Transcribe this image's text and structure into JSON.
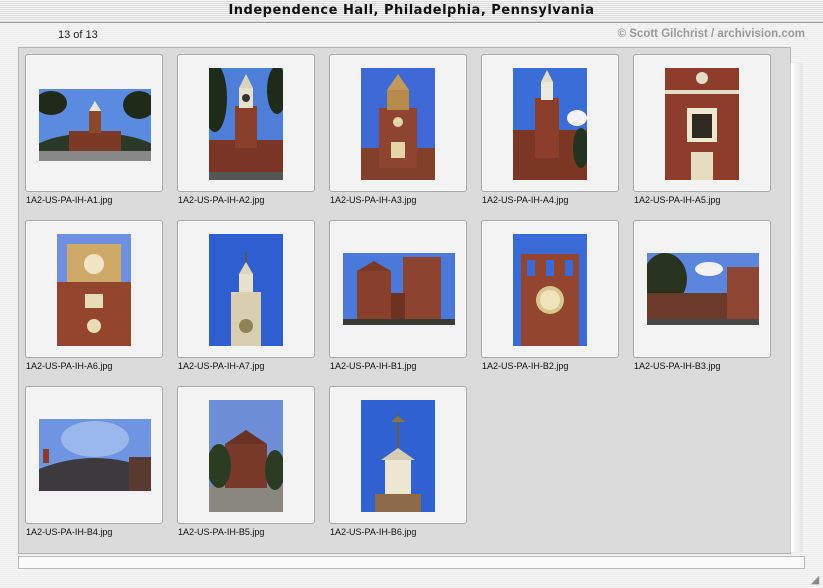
{
  "window": {
    "title": "Independence Hall, Philadelphia, Pennsylvania"
  },
  "header": {
    "count": "13 of 13",
    "credit": "© Scott Gilchrist / archivision.com"
  },
  "images": [
    {
      "filename": "1A2-US-PA-IH-A1.jpg",
      "orientation": "landscape",
      "subject": "fisheye view of hall and tower with trees"
    },
    {
      "filename": "1A2-US-PA-IH-A2.jpg",
      "orientation": "portrait",
      "subject": "hall tower framed by trees"
    },
    {
      "filename": "1A2-US-PA-IH-A3.jpg",
      "orientation": "portrait",
      "subject": "tower with clock, front facade"
    },
    {
      "filename": "1A2-US-PA-IH-A4.jpg",
      "orientation": "portrait",
      "subject": "tower side view, blue sky"
    },
    {
      "filename": "1A2-US-PA-IH-A5.jpg",
      "orientation": "portrait",
      "subject": "brick tower detail with window"
    },
    {
      "filename": "1A2-US-PA-IH-A6.jpg",
      "orientation": "portrait",
      "subject": "clock tower closeup"
    },
    {
      "filename": "1A2-US-PA-IH-A7.jpg",
      "orientation": "portrait",
      "subject": "cupola with clock against blue sky"
    },
    {
      "filename": "1A2-US-PA-IH-B1.jpg",
      "orientation": "landscape",
      "subject": "brick wings of the hall"
    },
    {
      "filename": "1A2-US-PA-IH-B2.jpg",
      "orientation": "portrait",
      "subject": "clock on brick wall"
    },
    {
      "filename": "1A2-US-PA-IH-B3.jpg",
      "orientation": "landscape",
      "subject": "arcade and tree"
    },
    {
      "filename": "1A2-US-PA-IH-B4.jpg",
      "orientation": "landscape",
      "subject": "wide fisheye sky view"
    },
    {
      "filename": "1A2-US-PA-IH-B5.jpg",
      "orientation": "portrait",
      "subject": "distant hall behind trees"
    },
    {
      "filename": "1A2-US-PA-IH-B6.jpg",
      "orientation": "portrait",
      "subject": "steeple top with weathervane"
    }
  ],
  "colors": {
    "sky": "#3f6fd6",
    "brick": "#8e3f2a",
    "pane": "#dbdbdb",
    "slide": "#f3f3f3"
  }
}
